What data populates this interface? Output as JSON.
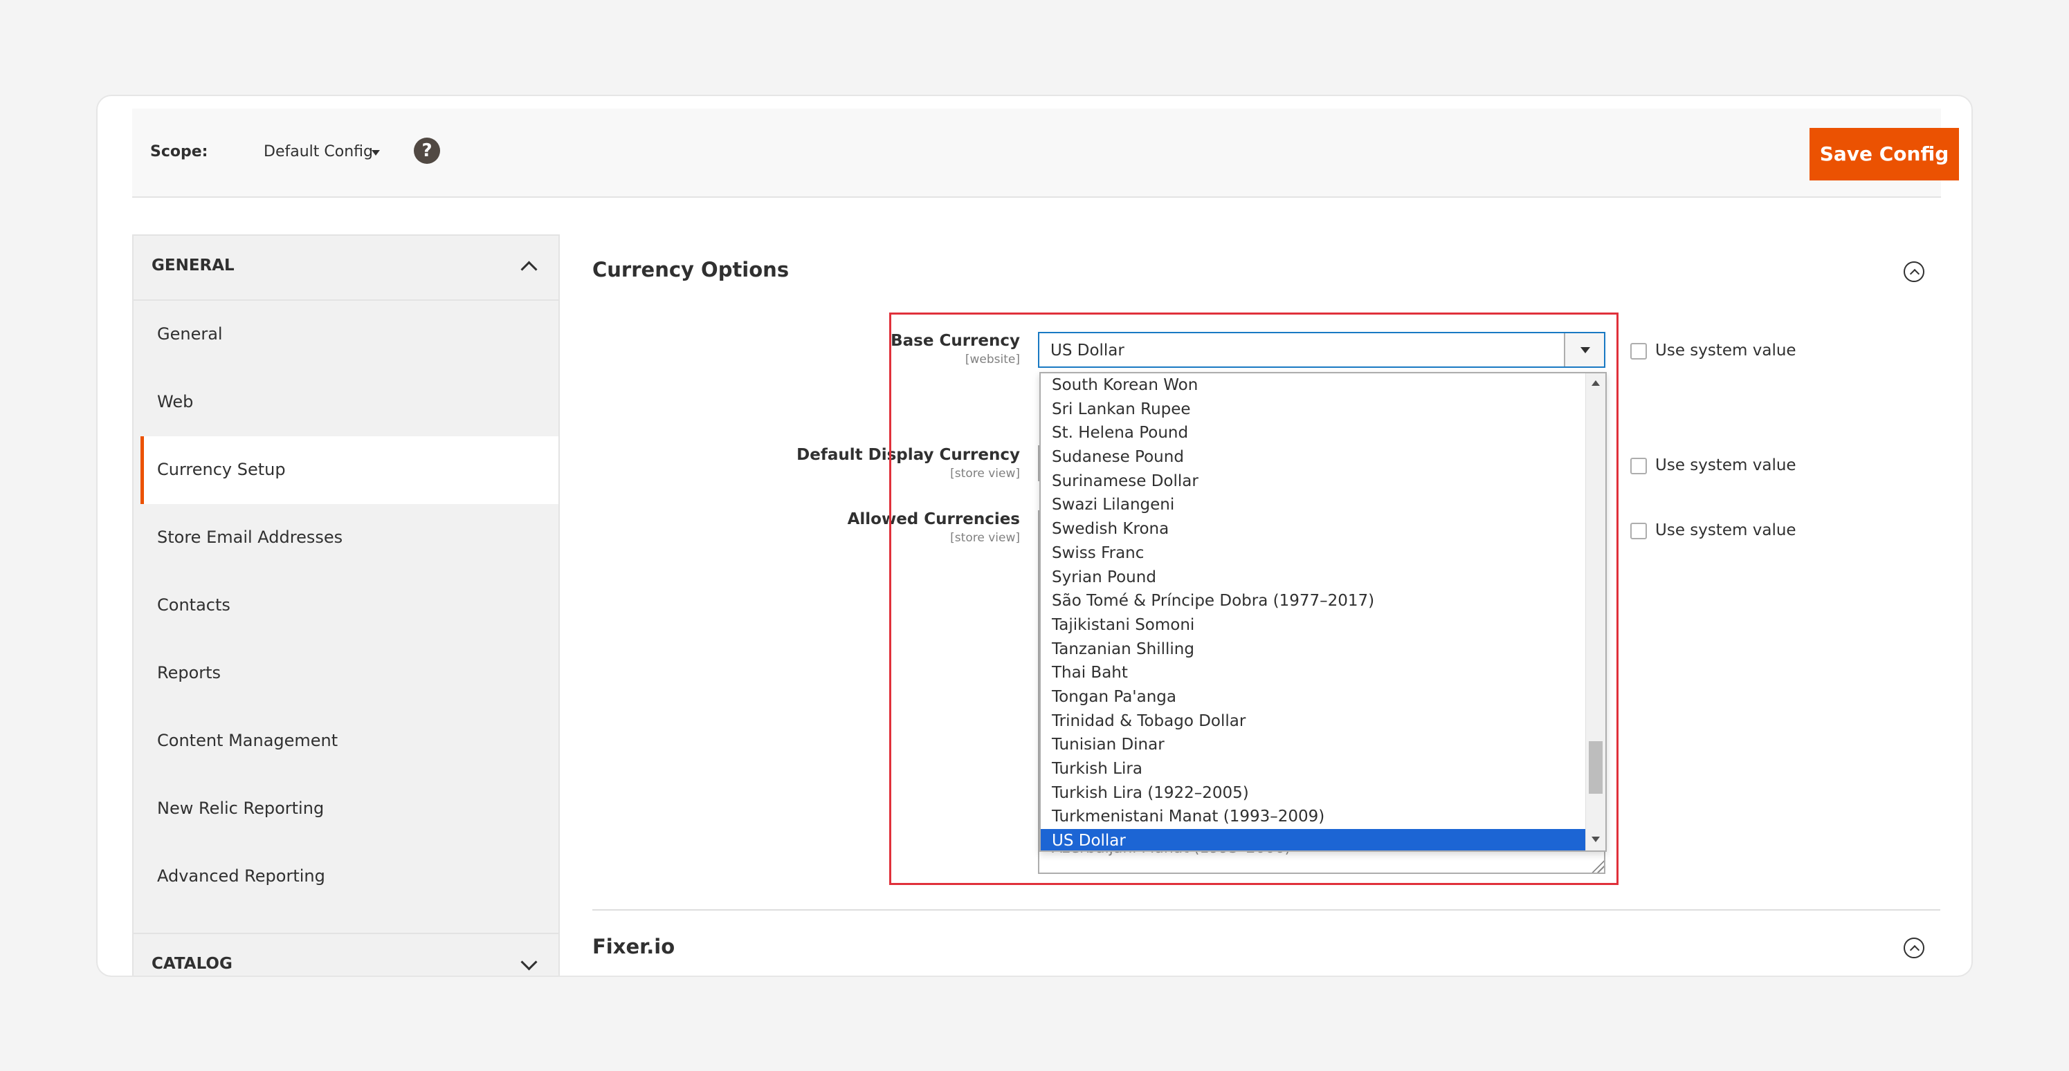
{
  "scope": {
    "label": "Scope:",
    "value": "Default Config"
  },
  "toolbar": {
    "save_label": "Save Config",
    "help_glyph": "?"
  },
  "sidebar": {
    "general_title": "GENERAL",
    "items": [
      {
        "label": "General"
      },
      {
        "label": "Web"
      },
      {
        "label": "Currency Setup",
        "active": true
      },
      {
        "label": "Store Email Addresses"
      },
      {
        "label": "Contacts"
      },
      {
        "label": "Reports"
      },
      {
        "label": "Content Management"
      },
      {
        "label": "New Relic Reporting"
      },
      {
        "label": "Advanced Reporting"
      }
    ],
    "catalog_title": "CATALOG"
  },
  "main": {
    "section_title": "Currency Options",
    "fields": {
      "base_currency": {
        "label": "Base Currency",
        "scope": "[website]",
        "value": "US Dollar"
      },
      "default_display_currency": {
        "label": "Default Display Currency",
        "scope": "[store view]"
      },
      "allowed_currencies": {
        "label": "Allowed Currencies",
        "scope": "[store view]",
        "partial_option": "Azerbaijani Manat (1993–2006)"
      }
    },
    "use_system_value": "Use system value",
    "dropdown_options": [
      "South Korean Won",
      "Sri Lankan Rupee",
      "St. Helena Pound",
      "Sudanese Pound",
      "Surinamese Dollar",
      "Swazi Lilangeni",
      "Swedish Krona",
      "Swiss Franc",
      "Syrian Pound",
      "São Tomé & Príncipe Dobra (1977–2017)",
      "Tajikistani Somoni",
      "Tanzanian Shilling",
      "Thai Baht",
      "Tongan Pa'anga",
      "Trinidad & Tobago Dollar",
      "Tunisian Dinar",
      "Turkish Lira",
      "Turkish Lira (1922–2005)",
      "Turkmenistani Manat (1993–2009)",
      "US Dollar"
    ],
    "selected_option": "US Dollar",
    "second_section_title": "Fixer.io"
  },
  "colors": {
    "accent": "#eb5202",
    "highlight": "#e0313b",
    "selected_option": "#1c65d4"
  }
}
